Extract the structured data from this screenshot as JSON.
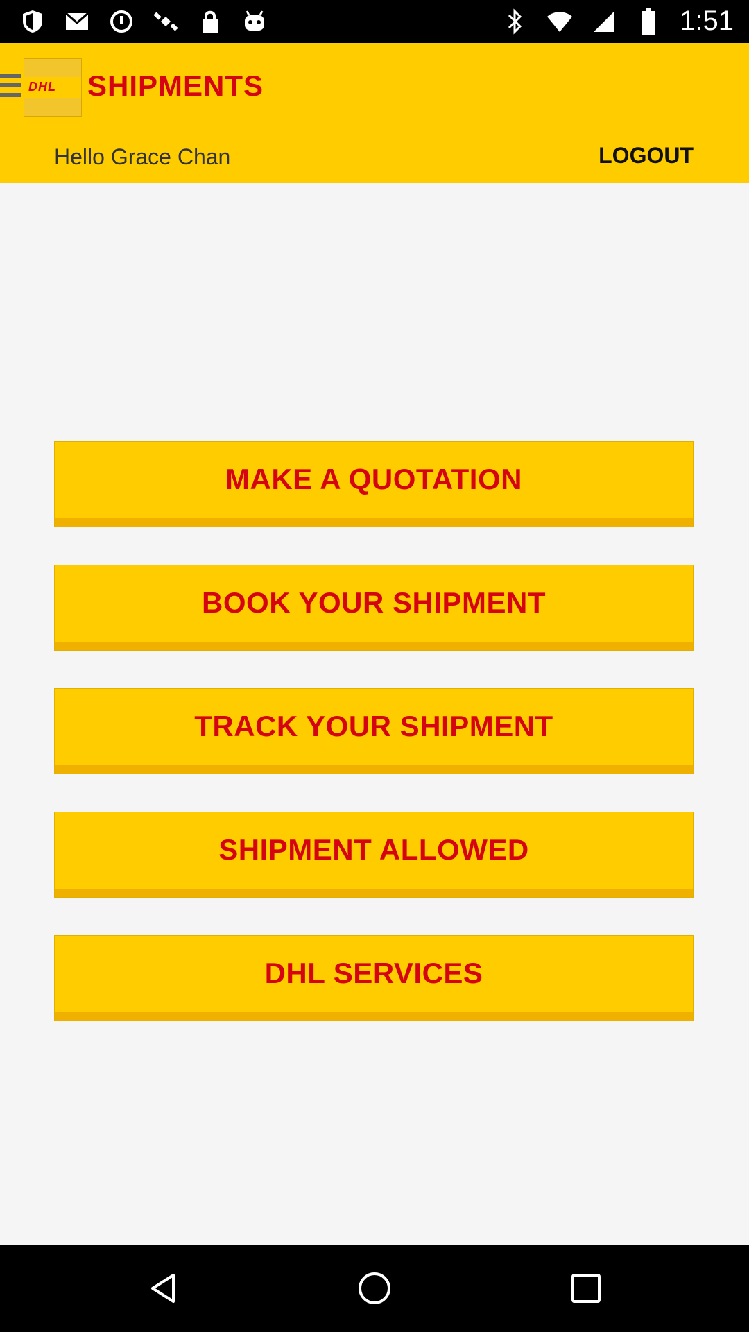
{
  "status_bar": {
    "time": "1:51",
    "icons": [
      "shield-icon",
      "mail-icon",
      "stopwatch-icon",
      "satellite-icon",
      "lock-icon",
      "android-icon",
      "bluetooth-icon",
      "wifi-icon",
      "signal-icon",
      "battery-icon"
    ]
  },
  "header": {
    "logo_text": "DHL",
    "title": "SHIPMENTS",
    "greeting": "Hello Grace Chan",
    "logout_label": "LOGOUT"
  },
  "menu": {
    "items": [
      {
        "label": "MAKE A QUOTATION"
      },
      {
        "label": "BOOK YOUR SHIPMENT"
      },
      {
        "label": "TRACK YOUR SHIPMENT"
      },
      {
        "label": "SHIPMENT ALLOWED"
      },
      {
        "label": "DHL SERVICES"
      }
    ]
  },
  "colors": {
    "brand_yellow": "#ffcc00",
    "brand_red": "#d40511"
  },
  "nav": {
    "icons": [
      "back-icon",
      "home-icon",
      "recents-icon"
    ]
  }
}
